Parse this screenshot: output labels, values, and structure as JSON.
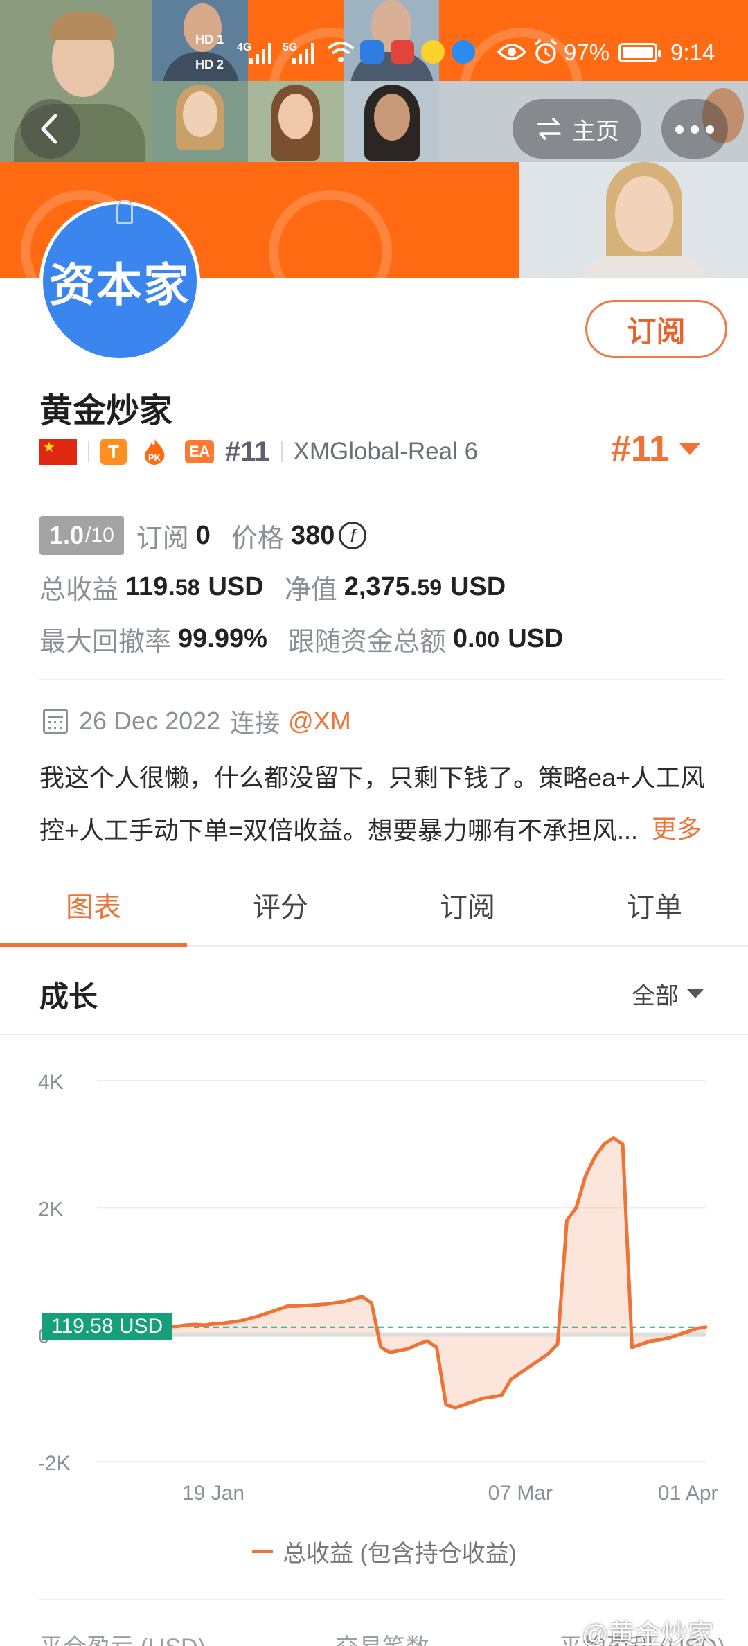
{
  "status_bar": {
    "hd1": "HD 1",
    "hd2": "HD 2",
    "net1": "4G",
    "net2": "5G",
    "battery": "97%",
    "time": "9:14"
  },
  "nav": {
    "back_icon": "chevron-left-icon",
    "home_label": "主页",
    "home_icon": "swap-icon",
    "more_icon": "more-dots-icon"
  },
  "profile": {
    "avatar_text": "资本家",
    "name": "黄金炒家",
    "subscribe_label": "订阅",
    "badge_t": "T",
    "badge_pk": "PK",
    "badge_ea": "EA",
    "rank_small": "#11",
    "server": "XMGlobal-Real 6",
    "rank_big": "#11"
  },
  "stats": {
    "score": "1.0",
    "score_max": "/10",
    "subs_label": "订阅",
    "subs_value": "0",
    "price_label": "价格",
    "price_value": "380",
    "coin_symbol": "f",
    "profit_label": "总收益",
    "profit_int": "119.",
    "profit_dec": "58",
    "profit_unit": "USD",
    "equity_label": "净值",
    "equity_int": "2,375.",
    "equity_dec": "59",
    "equity_unit": "USD",
    "drawdown_label": "最大回撤率",
    "drawdown_value": "99.99%",
    "follow_label": "跟随资金总额",
    "follow_int": "0.",
    "follow_dec": "00",
    "follow_unit": "USD"
  },
  "about": {
    "date": "26 Dec 2022",
    "connect_label": "连接",
    "broker": "@XM",
    "description": "我这个人很懒，什么都没留下，只剩下钱了。策略ea+人工风控+人工手动下单=双倍收益。想要暴力哪有不承担风...",
    "more_label": "更多"
  },
  "tabs": [
    {
      "label": "图表"
    },
    {
      "label": "评分"
    },
    {
      "label": "订阅"
    },
    {
      "label": "订单"
    }
  ],
  "growth": {
    "title": "成长",
    "range_label": "全部",
    "current_label": "119.58 USD",
    "legend_label": "总收益 (包含持仓收益)"
  },
  "chart_data": {
    "type": "area",
    "title": "",
    "xlabel": "",
    "ylabel": "",
    "ylim": [
      -2000,
      4000
    ],
    "yticks": [
      {
        "value": 4000,
        "label": "4K"
      },
      {
        "value": 2000,
        "label": "2K"
      },
      {
        "value": 0,
        "label": "0"
      },
      {
        "value": -2000,
        "label": "-2K"
      }
    ],
    "xticks": [
      {
        "index": 14,
        "label": "19 Jan"
      },
      {
        "index": 47,
        "label": "07 Mar"
      },
      {
        "index": 65,
        "label": "01 Apr"
      }
    ],
    "series": [
      {
        "name": "总收益 (包含持仓收益)",
        "color": "#ef7336",
        "values": [
          0,
          250,
          280,
          220,
          200,
          230,
          220,
          180,
          150,
          130,
          130,
          150,
          160,
          150,
          170,
          180,
          200,
          220,
          260,
          300,
          350,
          400,
          450,
          450,
          460,
          470,
          480,
          500,
          520,
          560,
          600,
          500,
          -200,
          -280,
          -250,
          -220,
          -150,
          -100,
          -200,
          -1100,
          -1150,
          -1100,
          -1050,
          -1000,
          -980,
          -950,
          -700,
          -600,
          -500,
          -400,
          -300,
          -150,
          1800,
          2000,
          2500,
          2800,
          3000,
          3100,
          3000,
          -200,
          -150,
          -100,
          -80,
          -50,
          0,
          50,
          100,
          120
        ]
      }
    ],
    "reference_line": {
      "value": 119.58,
      "color": "#15a07a"
    },
    "grid": true,
    "legend_position": "bottom"
  },
  "footer": {
    "col1": "平仓盈亏 (USD)",
    "col2": "交易笔数",
    "col3": "平均盈利 (USD)",
    "watermark": "@黄金炒家"
  }
}
